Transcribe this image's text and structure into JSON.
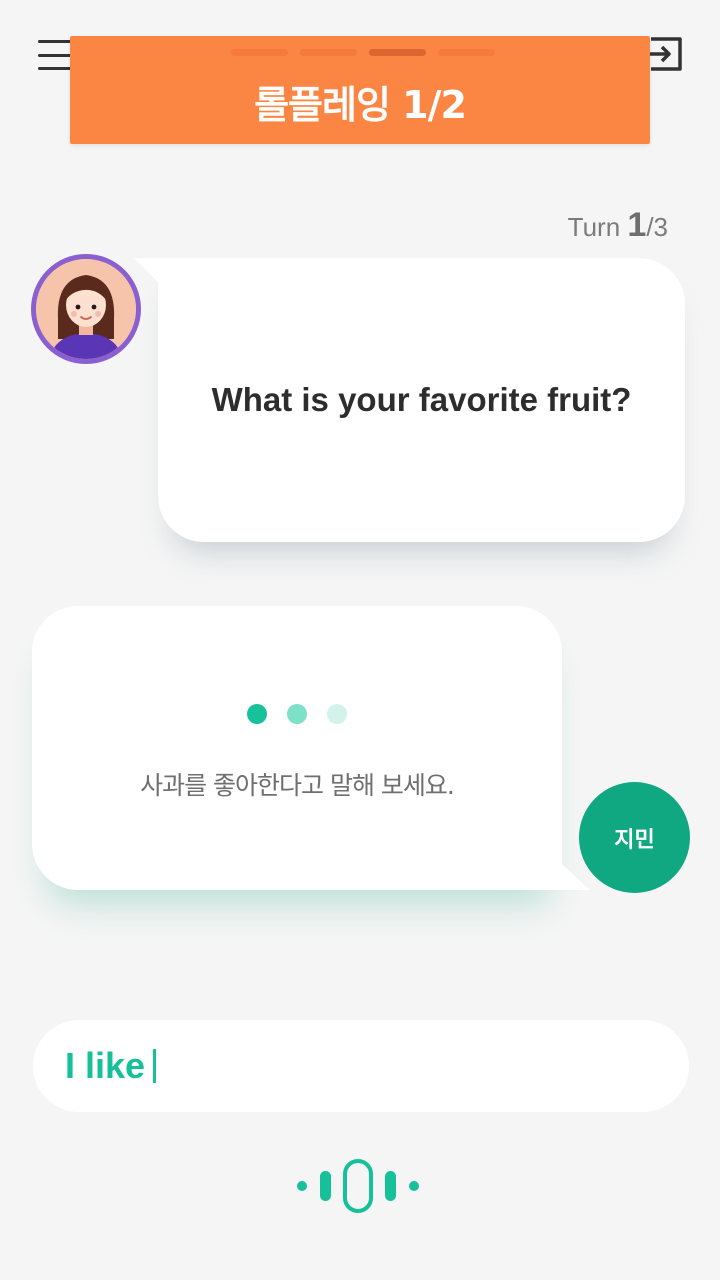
{
  "header": {
    "title": "롤플레잉 1/2",
    "progress_steps": 4,
    "progress_active_index": 2,
    "menu_icon": "hamburger-icon",
    "exit_icon": "exit-icon"
  },
  "turn": {
    "label": "Turn",
    "current": "1",
    "total": "/3"
  },
  "ai_message": {
    "text": "What is your favorite fruit?"
  },
  "user_message": {
    "hint": "사과를 좋아한다고 말해 보세요."
  },
  "user": {
    "name": "지민"
  },
  "input": {
    "value": "I like"
  },
  "voice": {
    "icon": "voice-wave-icon"
  },
  "colors": {
    "accent_orange": "#fb8644",
    "accent_green": "#16c099",
    "avatar_purple": "#8a5fcf",
    "user_avatar_green": "#10a880"
  }
}
